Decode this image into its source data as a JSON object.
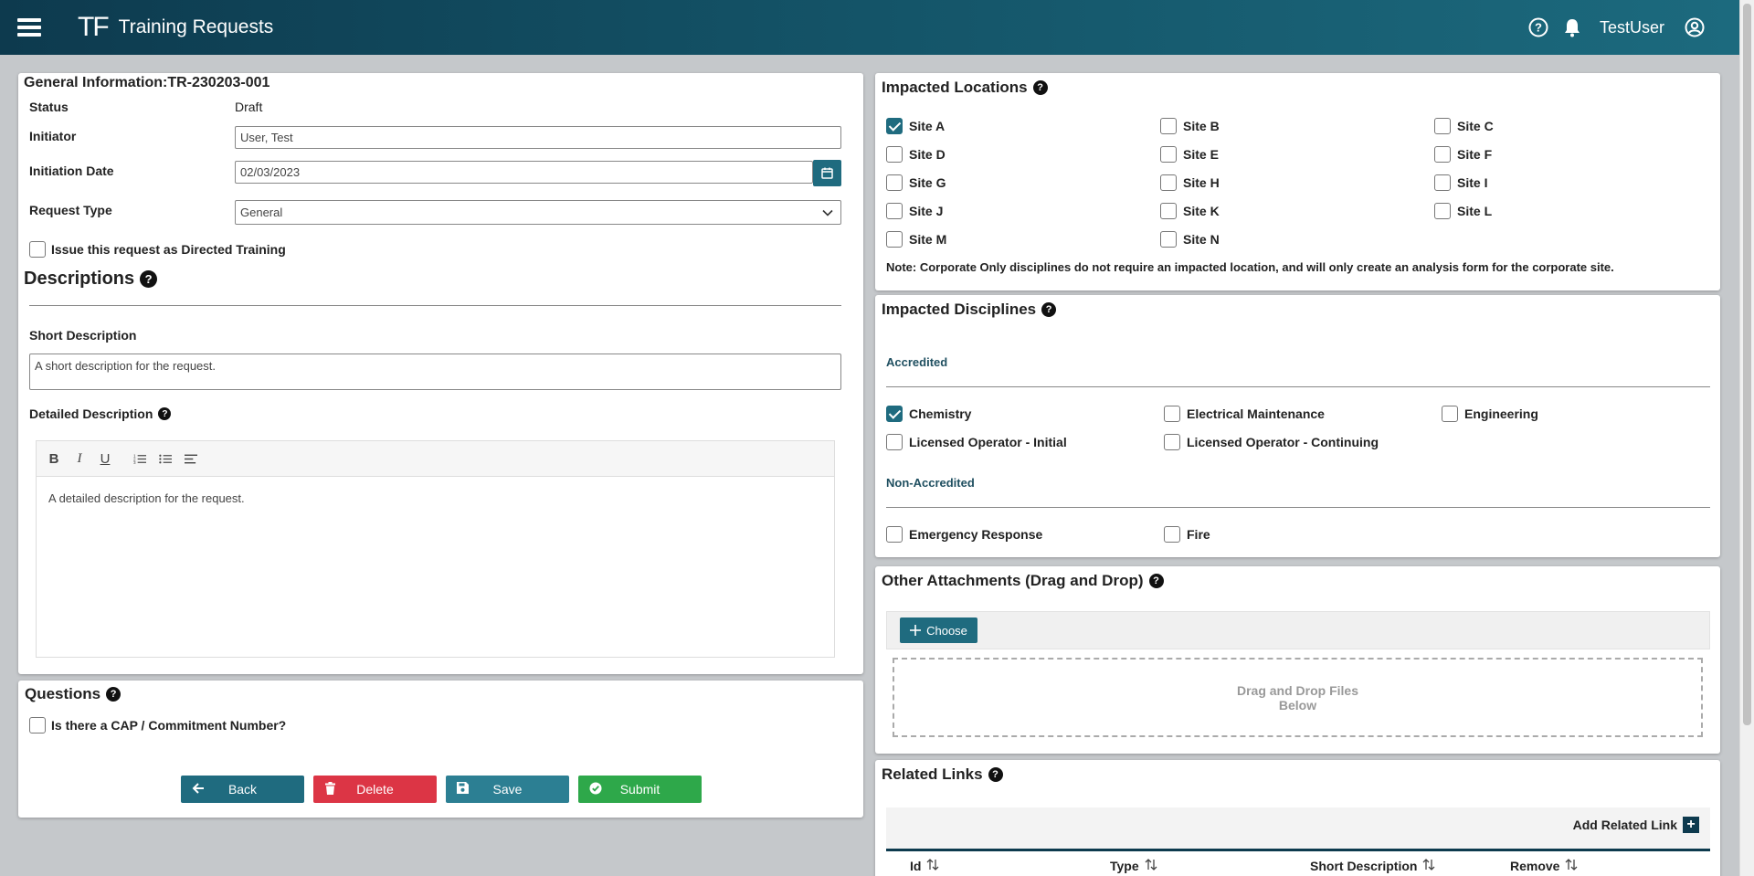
{
  "header": {
    "logo": "TF",
    "title": "Training Requests",
    "username": "TestUser"
  },
  "general": {
    "title": "General Information:TR-230203-001",
    "status_label": "Status",
    "status_value": "Draft",
    "initiator_label": "Initiator",
    "initiator_value": "User, Test",
    "initiation_date_label": "Initiation Date",
    "initiation_date_value": "02/03/2023",
    "request_type_label": "Request Type",
    "request_type_value": "General",
    "directed_training_label": "Issue this request as Directed Training",
    "directed_training_checked": false,
    "descriptions_title": "Descriptions",
    "short_desc_label": "Short Description",
    "short_desc_value": "A short description for the request.",
    "detailed_desc_label": "Detailed Description",
    "detailed_desc_value": "A detailed description for the request."
  },
  "questions": {
    "title": "Questions",
    "cap_label": "Is there a CAP / Commitment Number?",
    "cap_checked": false
  },
  "actions": {
    "back": "Back",
    "delete": "Delete",
    "save": "Save",
    "submit": "Submit"
  },
  "locations": {
    "title": "Impacted Locations",
    "sites": [
      {
        "label": "Site A",
        "checked": true
      },
      {
        "label": "Site B",
        "checked": false
      },
      {
        "label": "Site C",
        "checked": false
      },
      {
        "label": "Site D",
        "checked": false
      },
      {
        "label": "Site E",
        "checked": false
      },
      {
        "label": "Site F",
        "checked": false
      },
      {
        "label": "Site G",
        "checked": false
      },
      {
        "label": "Site H",
        "checked": false
      },
      {
        "label": "Site I",
        "checked": false
      },
      {
        "label": "Site J",
        "checked": false
      },
      {
        "label": "Site K",
        "checked": false
      },
      {
        "label": "Site L",
        "checked": false
      },
      {
        "label": "Site M",
        "checked": false
      },
      {
        "label": "Site N",
        "checked": false
      }
    ],
    "note": "Note: Corporate Only disciplines do not require an impacted location, and will only create an analysis form for the corporate site."
  },
  "disciplines": {
    "title": "Impacted Disciplines",
    "accredited_label": "Accredited",
    "accredited": [
      {
        "label": "Chemistry",
        "checked": true
      },
      {
        "label": "Electrical Maintenance",
        "checked": false
      },
      {
        "label": "Engineering",
        "checked": false
      },
      {
        "label": "Licensed Operator - Initial",
        "checked": false
      },
      {
        "label": "Licensed Operator - Continuing",
        "checked": false
      }
    ],
    "non_accredited_label": "Non-Accredited",
    "non_accredited": [
      {
        "label": "Emergency Response",
        "checked": false
      },
      {
        "label": "Fire",
        "checked": false
      }
    ]
  },
  "attachments": {
    "title": "Other Attachments (Drag and Drop)",
    "choose_label": "Choose",
    "drop_line1": "Drag and Drop Files",
    "drop_line2": "Below"
  },
  "links": {
    "title": "Related Links",
    "add_label": "Add Related Link",
    "columns": [
      "Id",
      "Type",
      "Short Description",
      "Remove"
    ]
  },
  "colors": {
    "primary": "#1f6b7f",
    "danger": "#dc3545",
    "success": "#2ea84a",
    "header_dark": "#0d3a4e"
  }
}
